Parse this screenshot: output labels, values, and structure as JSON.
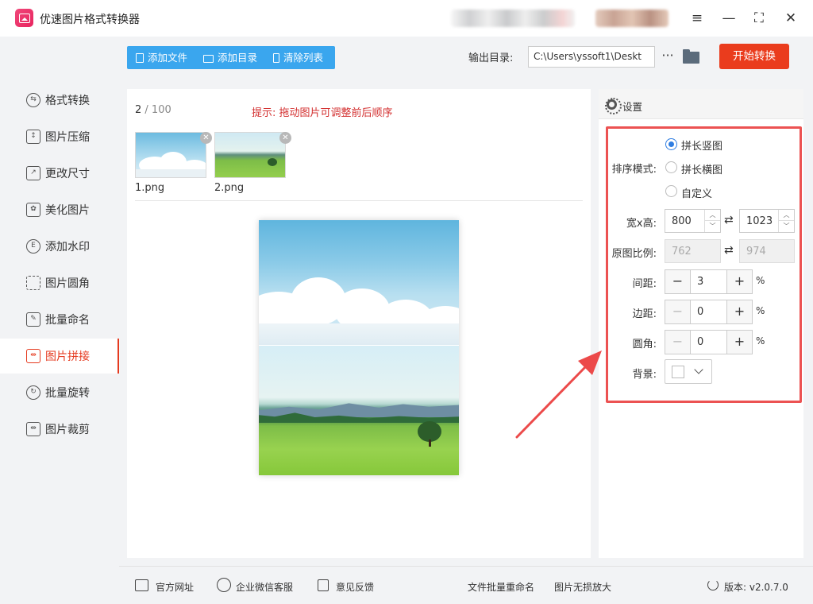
{
  "window": {
    "title": "优速图片格式转换器",
    "controls": {
      "menu": "≡",
      "minimize": "—",
      "maximize": "⛶",
      "close": "✕"
    }
  },
  "sidebar": {
    "items": [
      {
        "label": "格式转换",
        "icon": "format-convert-icon"
      },
      {
        "label": "图片压缩",
        "icon": "compress-icon"
      },
      {
        "label": "更改尺寸",
        "icon": "resize-icon"
      },
      {
        "label": "美化图片",
        "icon": "beautify-icon"
      },
      {
        "label": "添加水印",
        "icon": "watermark-icon"
      },
      {
        "label": "图片圆角",
        "icon": "round-corner-icon"
      },
      {
        "label": "批量命名",
        "icon": "rename-icon"
      },
      {
        "label": "图片拼接",
        "icon": "stitch-icon",
        "active": true
      },
      {
        "label": "批量旋转",
        "icon": "rotate-icon"
      },
      {
        "label": "图片裁剪",
        "icon": "crop-icon"
      }
    ]
  },
  "toolbar": {
    "add_file": "添加文件",
    "add_dir": "添加目录",
    "clear_list": "清除列表",
    "output_label": "输出目录:",
    "output_path": "C:\\Users\\yssoft1\\Deskt",
    "more": "···",
    "start": "开始转换"
  },
  "file_list": {
    "count": "2",
    "max": "/ 100",
    "hint": "提示: 拖动图片可调整前后顺序",
    "files": [
      {
        "name": "1.png"
      },
      {
        "name": "2.png"
      }
    ]
  },
  "settings": {
    "title": "设置",
    "sort_label": "排序模式:",
    "sort_options": [
      {
        "label": "拼长竖图",
        "checked": true
      },
      {
        "label": "拼长横图",
        "checked": false
      },
      {
        "label": "自定义",
        "checked": false
      }
    ],
    "size_label": "宽x高:",
    "width": "800",
    "height": "1023",
    "ratio_label": "原图比例:",
    "ratio_w": "762",
    "ratio_h": "974",
    "spacing_label": "间距:",
    "spacing": "3",
    "margin_label": "边距:",
    "margin": "0",
    "radius_label": "圆角:",
    "radius": "0",
    "pct": "%",
    "bg_label": "背景:",
    "bg_color": "#ffffff"
  },
  "footer": {
    "website": "官方网址",
    "wechat": "企业微信客服",
    "feedback": "意见反馈",
    "batch_rename": "文件批量重命名",
    "lossless": "图片无损放大",
    "version": "版本: v2.0.7.0"
  },
  "colors": {
    "accent": "#e53a1f",
    "toolbar": "#3aa6ee",
    "hint": "#d32f2f",
    "highlight": "#ec5252"
  }
}
